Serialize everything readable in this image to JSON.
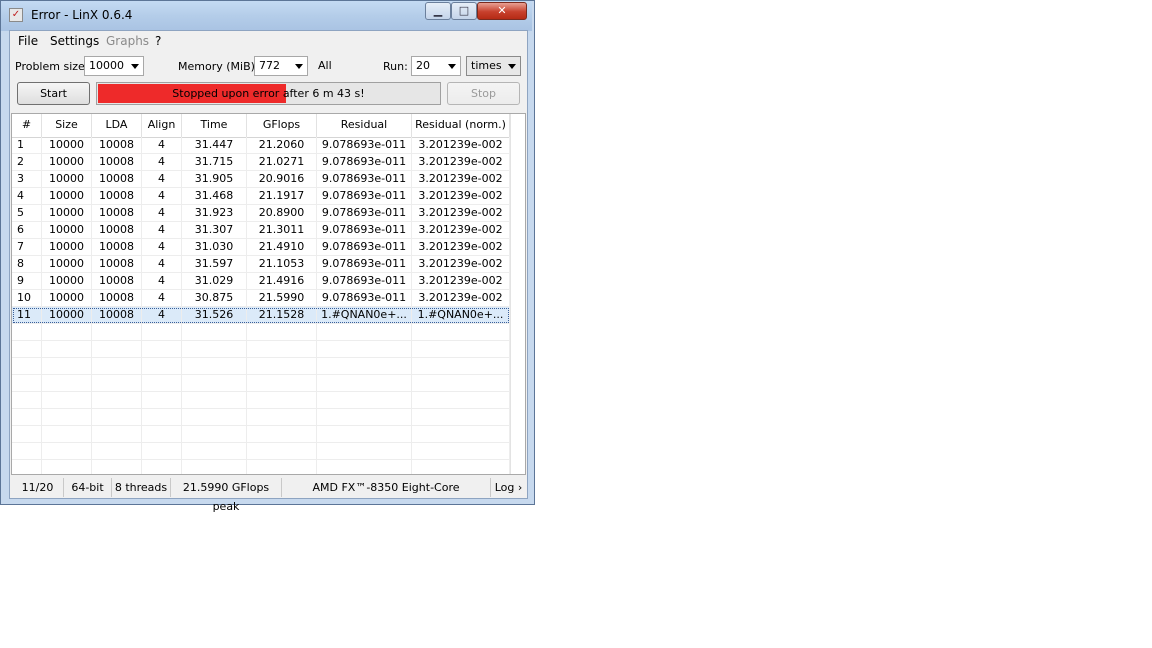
{
  "window": {
    "title": "Error - LinX 0.6.4",
    "icons": {
      "app": "linx-app-icon",
      "minimize": "minimize-icon",
      "maximize": "maximize-icon",
      "close": "close-icon"
    }
  },
  "menu": {
    "items": [
      "File",
      "Settings",
      "Graphs",
      "?"
    ]
  },
  "controls": {
    "problem_size_label": "Problem size:",
    "problem_size_value": "10000",
    "memory_label": "Memory (MiB):",
    "memory_value": "772",
    "all_label": "All",
    "run_label": "Run:",
    "run_value": "20",
    "run_unit": "times",
    "start_label": "Start",
    "stop_label": "Stop",
    "progress_text": "Stopped upon error after 6 m 43 s!",
    "progress_color": "#ee2a2a"
  },
  "table": {
    "columns": [
      "#",
      "Size",
      "LDA",
      "Align",
      "Time",
      "GFlops",
      "Residual",
      "Residual (norm.)"
    ],
    "rows": [
      [
        "1",
        "10000",
        "10008",
        "4",
        "31.447",
        "21.2060",
        "9.078693e-011",
        "3.201239e-002"
      ],
      [
        "2",
        "10000",
        "10008",
        "4",
        "31.715",
        "21.0271",
        "9.078693e-011",
        "3.201239e-002"
      ],
      [
        "3",
        "10000",
        "10008",
        "4",
        "31.905",
        "20.9016",
        "9.078693e-011",
        "3.201239e-002"
      ],
      [
        "4",
        "10000",
        "10008",
        "4",
        "31.468",
        "21.1917",
        "9.078693e-011",
        "3.201239e-002"
      ],
      [
        "5",
        "10000",
        "10008",
        "4",
        "31.923",
        "20.8900",
        "9.078693e-011",
        "3.201239e-002"
      ],
      [
        "6",
        "10000",
        "10008",
        "4",
        "31.307",
        "21.3011",
        "9.078693e-011",
        "3.201239e-002"
      ],
      [
        "7",
        "10000",
        "10008",
        "4",
        "31.030",
        "21.4910",
        "9.078693e-011",
        "3.201239e-002"
      ],
      [
        "8",
        "10000",
        "10008",
        "4",
        "31.597",
        "21.1053",
        "9.078693e-011",
        "3.201239e-002"
      ],
      [
        "9",
        "10000",
        "10008",
        "4",
        "31.029",
        "21.4916",
        "9.078693e-011",
        "3.201239e-002"
      ],
      [
        "10",
        "10000",
        "10008",
        "4",
        "30.875",
        "21.5990",
        "9.078693e-011",
        "3.201239e-002"
      ],
      [
        "11",
        "10000",
        "10008",
        "4",
        "31.526",
        "21.1528",
        "1.#QNAN0e+...",
        "1.#QNAN0e+..."
      ]
    ],
    "selected_row": 10
  },
  "status": {
    "progress": "11/20",
    "bits": "64-bit",
    "threads": "8 threads",
    "peak": "21.5990 GFlops peak",
    "cpu": "AMD FX™-8350 Eight-Core",
    "log_label": "Log ›"
  }
}
